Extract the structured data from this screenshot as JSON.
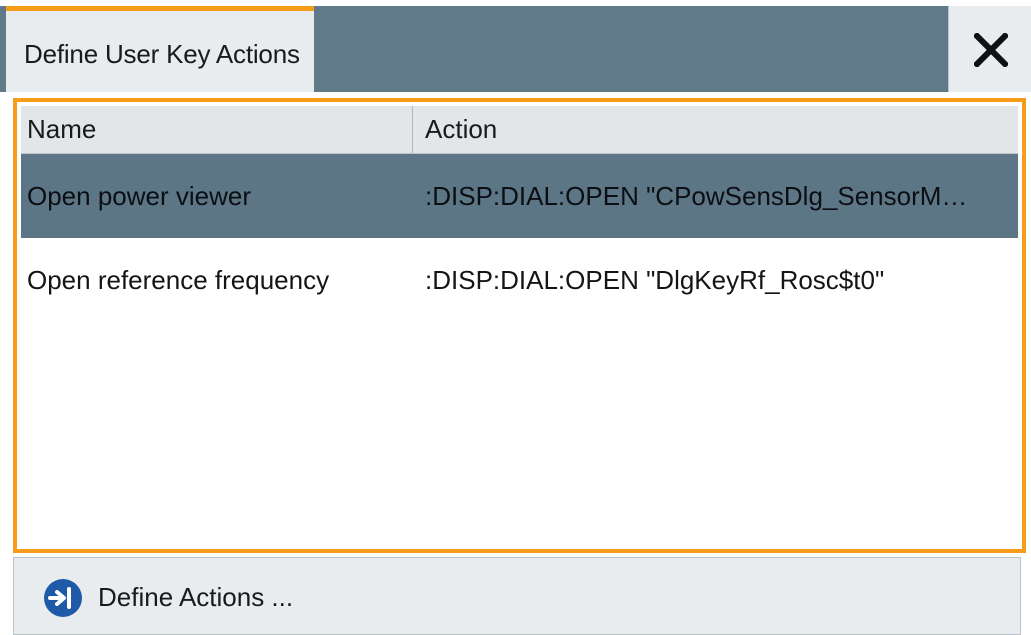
{
  "dialog": {
    "title": "Define User Key Actions",
    "close_icon": "close-icon"
  },
  "table": {
    "columns": [
      "Name",
      "Action"
    ],
    "rows": [
      {
        "name": "Open power viewer",
        "action": ":DISP:DIAL:OPEN \"CPowSensDlg_SensorM…",
        "selected": true
      },
      {
        "name": "Open reference frequency",
        "action": ":DISP:DIAL:OPEN \"DlgKeyRf_Rosc$t0\"",
        "selected": false
      }
    ]
  },
  "footer": {
    "button_label": "Define Actions ...",
    "button_icon": "arrow-right-icon"
  },
  "colors": {
    "accent": "#f59c1a",
    "header_bg": "#607a8a",
    "selected_row": "#5d7686",
    "icon_blue": "#1f5aa8"
  }
}
